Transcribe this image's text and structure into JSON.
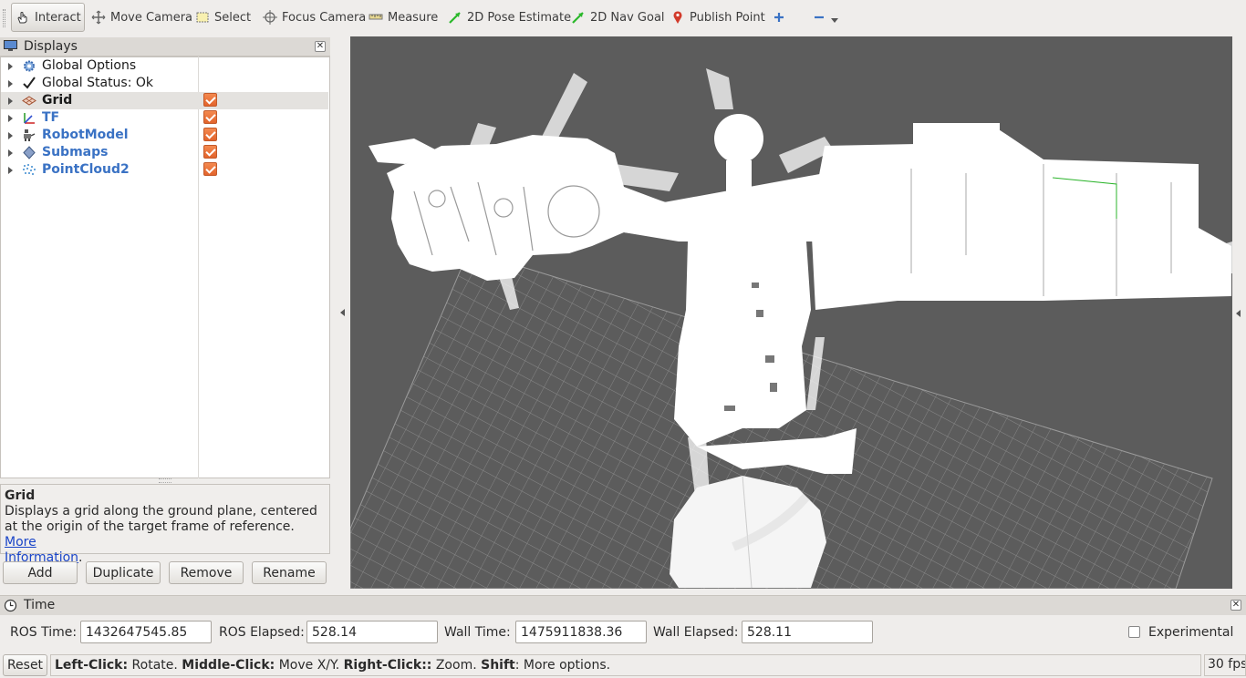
{
  "toolbar": {
    "interact": "Interact",
    "move_camera": "Move Camera",
    "select": "Select",
    "focus_camera": "Focus Camera",
    "measure": "Measure",
    "pose_estimate": "2D Pose Estimate",
    "nav_goal": "2D Nav Goal",
    "publish_point": "Publish Point"
  },
  "displays": {
    "title": "Displays",
    "items": [
      {
        "label": "Global Options",
        "style": "normal",
        "icon": "gear-icon",
        "checked": null
      },
      {
        "label": "Global Status: Ok",
        "style": "normal",
        "icon": "checkmark-icon",
        "checked": null
      },
      {
        "label": "Grid",
        "style": "bold",
        "icon": "grid-icon",
        "checked": true
      },
      {
        "label": "TF",
        "style": "blue",
        "icon": "tf-icon",
        "checked": true
      },
      {
        "label": "RobotModel",
        "style": "blue",
        "icon": "robot-icon",
        "checked": true
      },
      {
        "label": "Submaps",
        "style": "blue",
        "icon": "submap-icon",
        "checked": true
      },
      {
        "label": "PointCloud2",
        "style": "blue",
        "icon": "pointcloud-icon",
        "checked": true
      }
    ]
  },
  "description": {
    "title": "Grid",
    "text": "Displays a grid along the ground plane, centered at the origin of the target frame of reference.",
    "link_more": "More",
    "link_info": "Information"
  },
  "buttons": {
    "add": "Add",
    "duplicate": "Duplicate",
    "remove": "Remove",
    "rename": "Rename"
  },
  "time": {
    "title": "Time",
    "ros_time_label": "ROS Time:",
    "ros_time": "1432647545.85",
    "ros_elapsed_label": "ROS Elapsed:",
    "ros_elapsed": "528.14",
    "wall_time_label": "Wall Time:",
    "wall_time": "1475911838.36",
    "wall_elapsed_label": "Wall Elapsed:",
    "wall_elapsed": "528.11",
    "experimental": "Experimental"
  },
  "status": {
    "reset": "Reset",
    "left_click": "Left-Click:",
    "left_click_action": "Rotate.",
    "middle_click": "Middle-Click:",
    "middle_click_action": "Move X/Y.",
    "right_click": "Right-Click::",
    "right_click_action": "Zoom.",
    "shift": "Shift",
    "shift_action": ": More options.",
    "fps": "30 fps"
  },
  "colors": {
    "accent_blue": "#3a72c4",
    "checkbox_orange": "#e8703a",
    "viewport_bg": "#5c5c5c",
    "map_white": "#ffffff"
  }
}
